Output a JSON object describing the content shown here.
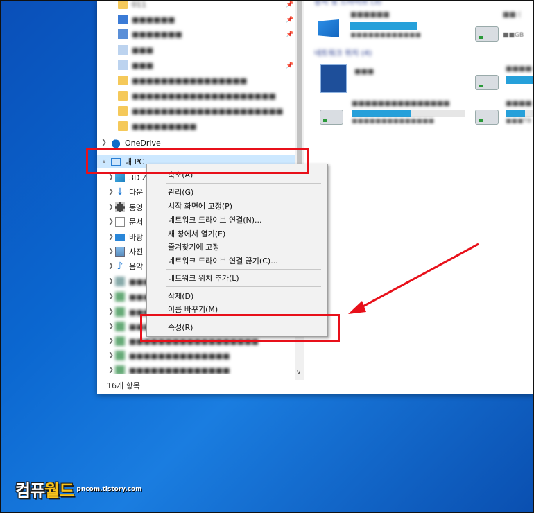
{
  "nav": {
    "items_blurred": [
      "011",
      "...",
      "...",
      "...",
      "...",
      "...",
      "...",
      "..."
    ],
    "onedrive": "OneDrive",
    "mypc": "내 PC",
    "children": [
      "3D 개",
      "다운",
      "동영",
      "문서",
      "바탕",
      "사진",
      "음악"
    ],
    "status": "16개 항목"
  },
  "content": {
    "section_devices": "장치 및 드라이브 (3)",
    "section_network": "네트워크 위치 (4)"
  },
  "context_menu": {
    "items": [
      "축소(A)",
      "관리(G)",
      "시작 화면에 고정(P)",
      "네트워크 드라이브 연결(N)...",
      "새 창에서 열기(E)",
      "즐겨찾기에 고정",
      "네트워크 드라이브 연결 끊기(C)...",
      "네트워크 위치 추가(L)",
      "삭제(D)",
      "이름 바꾸기(M)",
      "속성(R)"
    ]
  },
  "logo": {
    "main_white": "컴퓨",
    "main_gold": "월드",
    "sub": "pncom.tistory.com"
  },
  "colors": {
    "highlight_red": "#e8101a",
    "selection": "#cce8ff",
    "progress": "#26a0da",
    "logo_gold": "#f7c21a"
  }
}
